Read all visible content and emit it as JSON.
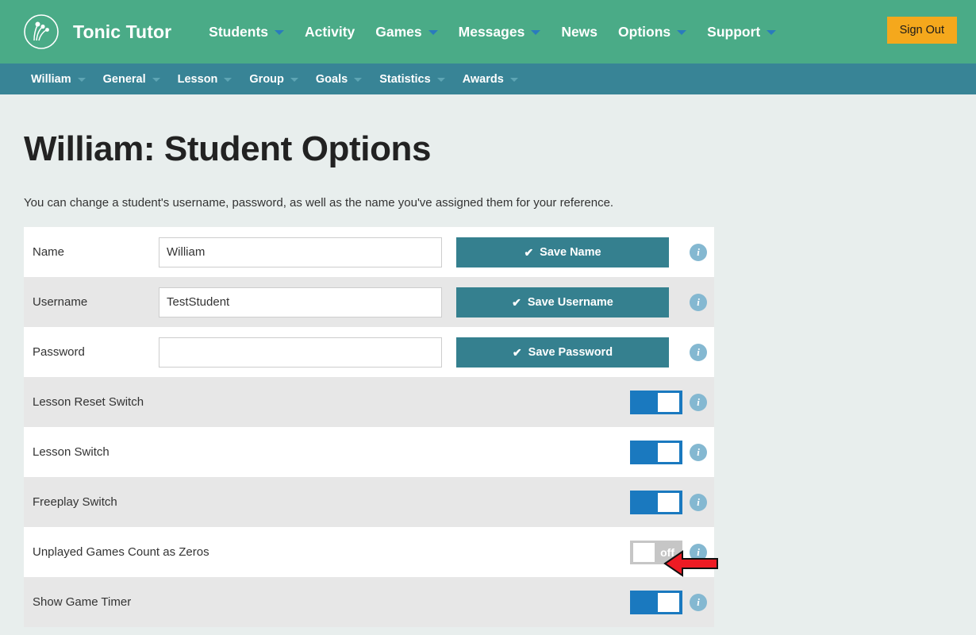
{
  "header": {
    "logo_icon": "tonic-tutor-logo-icon",
    "brand": "Tonic Tutor",
    "nav": [
      {
        "label": "Students",
        "has_caret": true
      },
      {
        "label": "Activity",
        "has_caret": false
      },
      {
        "label": "Games",
        "has_caret": true
      },
      {
        "label": "Messages",
        "has_caret": true
      },
      {
        "label": "News",
        "has_caret": false
      },
      {
        "label": "Options",
        "has_caret": true
      },
      {
        "label": "Support",
        "has_caret": true
      }
    ],
    "sign_out_label": "Sign Out"
  },
  "subnav": {
    "items": [
      {
        "label": "William",
        "has_caret": true
      },
      {
        "label": "General",
        "has_caret": true
      },
      {
        "label": "Lesson",
        "has_caret": true
      },
      {
        "label": "Group",
        "has_caret": true
      },
      {
        "label": "Goals",
        "has_caret": true
      },
      {
        "label": "Statistics",
        "has_caret": true
      },
      {
        "label": "Awards",
        "has_caret": true
      }
    ]
  },
  "main": {
    "title": "William: Student Options",
    "description": "You can change a student's username, password, as well as the name you've assigned them for your reference.",
    "field_rows": [
      {
        "label": "Name",
        "value": "William",
        "placeholder": "",
        "button_label": "Save Name",
        "button_icon": "check-icon",
        "info_icon": "info-icon"
      },
      {
        "label": "Username",
        "value": "TestStudent",
        "placeholder": "",
        "button_label": "Save Username",
        "button_icon": "check-icon",
        "info_icon": "info-icon"
      },
      {
        "label": "Password",
        "value": "",
        "placeholder": "",
        "button_label": "Save Password",
        "button_icon": "check-icon",
        "info_icon": "info-icon"
      }
    ],
    "switch_rows": [
      {
        "label": "Lesson Reset Switch",
        "state": "on",
        "state_label": "",
        "info_icon": "info-icon"
      },
      {
        "label": "Lesson Switch",
        "state": "on",
        "state_label": "",
        "info_icon": "info-icon"
      },
      {
        "label": "Freeplay Switch",
        "state": "on",
        "state_label": "",
        "info_icon": "info-icon"
      },
      {
        "label": "Unplayed Games Count as Zeros",
        "state": "off",
        "state_label": "off",
        "info_icon": "info-icon"
      },
      {
        "label": "Show Game Timer",
        "state": "on",
        "state_label": "",
        "info_icon": "info-icon"
      }
    ]
  },
  "annotation": {
    "arrow_icon": "red-left-arrow-icon",
    "arrow_color": "#ee1b24",
    "points_at": "Unplayed Games Count as Zeros"
  },
  "colors": {
    "header_green": "#4aab87",
    "subnav_teal": "#388496",
    "page_background": "#e8eeed",
    "save_button_teal": "#35808f",
    "sign_out_amber": "#f5a81c",
    "toggle_on_blue": "#1a79bf",
    "toggle_off_gray": "#c6c6c6",
    "info_icon_blue": "#84b8d1",
    "row_alt_gray": "#e7e7e7"
  }
}
